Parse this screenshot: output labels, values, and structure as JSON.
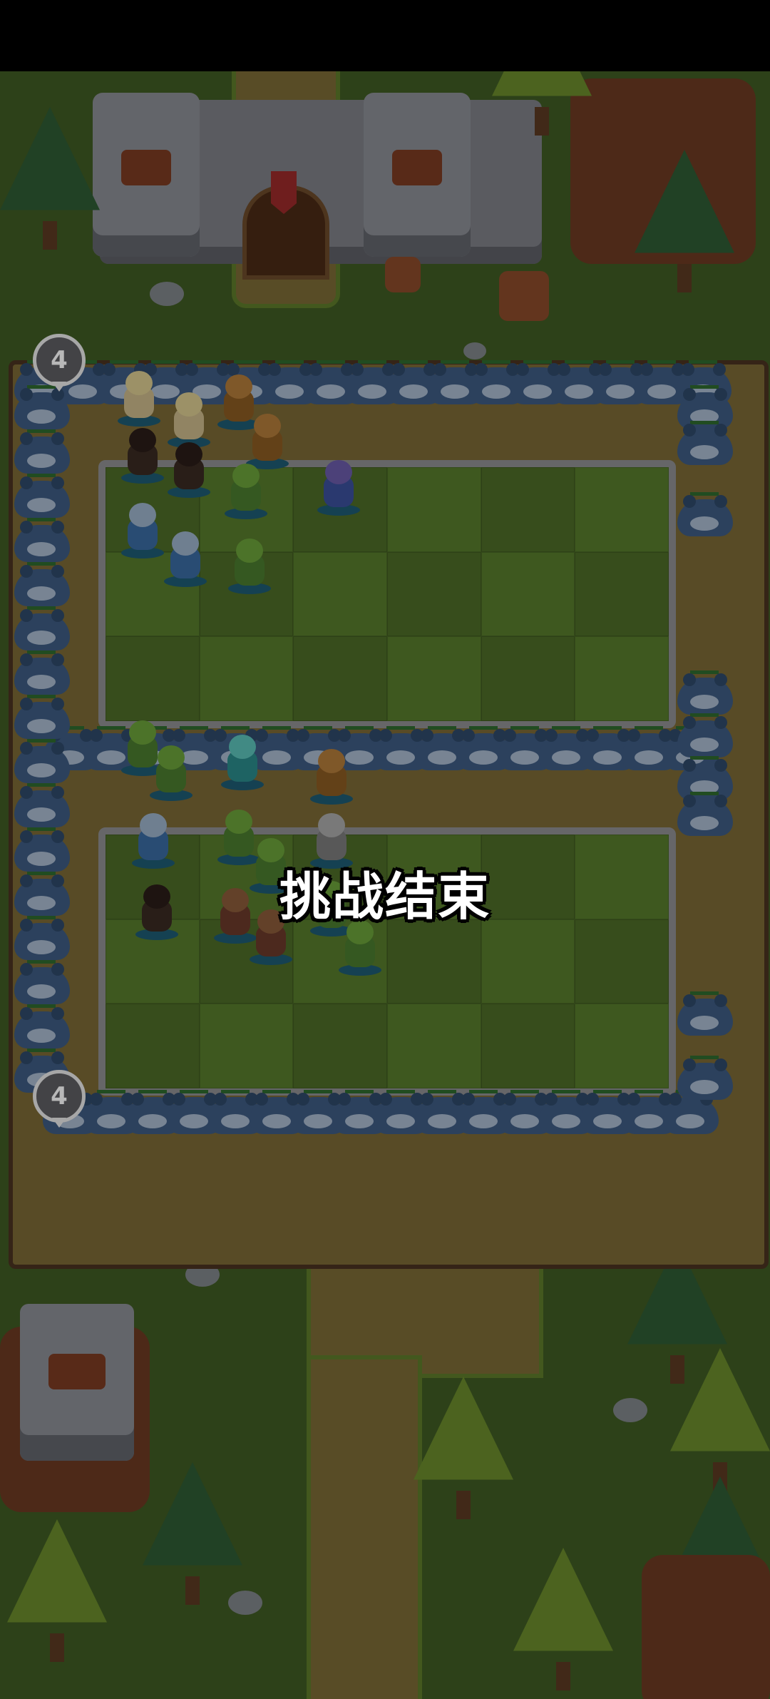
{
  "game": {
    "end_message": "挑战结束",
    "wave_counter_top": "4",
    "wave_counter_bottom": "4"
  },
  "colors": {
    "grass_dark": "#3f5a23",
    "path": "#7a6a35",
    "bear": "#3d5a82",
    "wall": "#8e8e91"
  },
  "icons": [
    "castle-icon",
    "bear-enemy-icon",
    "hero-unit-icon",
    "tree-icon",
    "rock-icon"
  ]
}
